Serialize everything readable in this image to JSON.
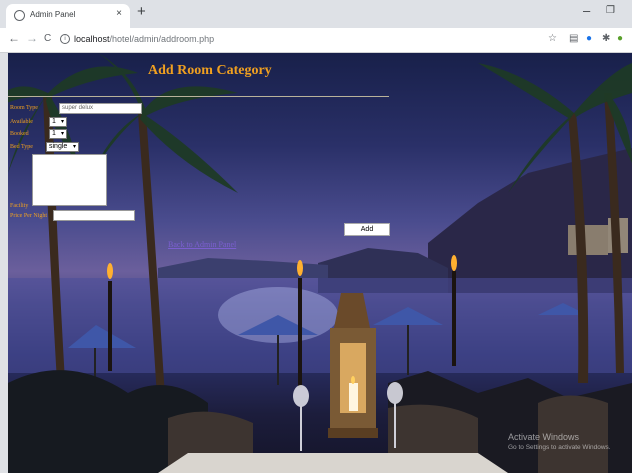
{
  "browser": {
    "tab_title": "Admin Panel",
    "tab_close": "×",
    "new_tab": "+",
    "minimize": "–",
    "maximize": "❐",
    "back": "←",
    "forward": "→",
    "reload": "C",
    "url_host": "localhost",
    "url_path": "/hotel/admin/addroom.php",
    "icons": [
      "star-icon",
      "reading-list-icon",
      "extension-icon",
      "puzzle-icon",
      "profile-icon"
    ]
  },
  "page": {
    "heading": "Add Room Category",
    "form": {
      "room_type_label": "Room Type",
      "room_type_value": "super delux",
      "available_label": "Available",
      "available_value": "1",
      "bookable_label": "Booked",
      "bookable_value": "1",
      "bed_type_label": "Bed Type",
      "bed_type_value": "single",
      "facility_label": "Facility",
      "price_label": "Price Per Night",
      "price_value": "",
      "add_button": "Add"
    },
    "back_link": "Back to Admin Panel",
    "watermark_line1": "Activate Windows",
    "watermark_line2": "Go to Settings to activate Windows."
  }
}
